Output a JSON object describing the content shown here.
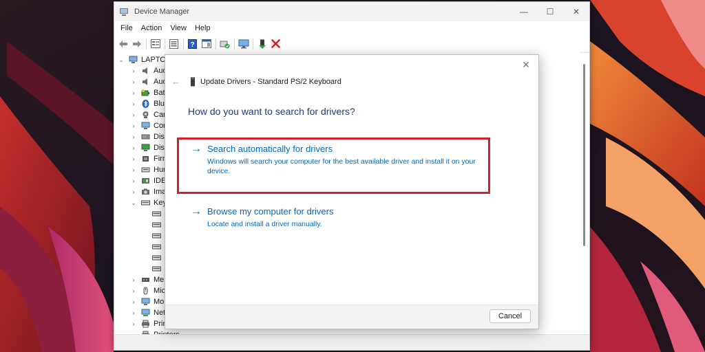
{
  "window": {
    "title": "Device Manager",
    "controls": {
      "minimize": "—",
      "maximize": "☐",
      "close": "✕"
    }
  },
  "menu": [
    "File",
    "Action",
    "View",
    "Help"
  ],
  "tree": {
    "root": "LAPTOP",
    "categories": [
      {
        "label": "Aud",
        "icon": "speaker-icon",
        "expanded": false
      },
      {
        "label": "Aud",
        "icon": "speaker-icon",
        "expanded": false
      },
      {
        "label": "Batt",
        "icon": "battery-icon",
        "expanded": false
      },
      {
        "label": "Blue",
        "icon": "bluetooth-icon",
        "expanded": false
      },
      {
        "label": "Can",
        "icon": "camera-icon",
        "expanded": false
      },
      {
        "label": "Com",
        "icon": "computer-icon",
        "expanded": false
      },
      {
        "label": "Disk",
        "icon": "disk-icon",
        "expanded": false
      },
      {
        "label": "Disp",
        "icon": "display-icon",
        "expanded": false
      },
      {
        "label": "Firm",
        "icon": "firmware-icon",
        "expanded": false
      },
      {
        "label": "Hum",
        "icon": "hid-icon",
        "expanded": false
      },
      {
        "label": "IDE",
        "icon": "ide-icon",
        "expanded": false
      },
      {
        "label": "Ima",
        "icon": "imaging-icon",
        "expanded": false
      },
      {
        "label": "Key",
        "icon": "keyboard-icon",
        "expanded": true
      }
    ],
    "keyboard_children": 6,
    "categories_after": [
      {
        "label": "Mer",
        "icon": "memory-icon"
      },
      {
        "label": "Mic",
        "icon": "mouse-icon"
      },
      {
        "label": "Mo",
        "icon": "monitor-icon"
      },
      {
        "label": "Net",
        "icon": "network-icon"
      },
      {
        "label": "Prin",
        "icon": "print-queue-icon"
      },
      {
        "label": "Printers",
        "icon": "printer-icon"
      }
    ]
  },
  "dialog": {
    "title": "Update Drivers - Standard PS/2 Keyboard",
    "close": "✕",
    "back": "←",
    "question": "How do you want to search for drivers?",
    "options": [
      {
        "title": "Search automatically for drivers",
        "description": "Windows will search your computer for the best available driver and install it on your device."
      },
      {
        "title": "Browse my computer for drivers",
        "description": "Locate and install a driver manually."
      }
    ],
    "cancel_label": "Cancel"
  },
  "colors": {
    "link_blue": "#0067c0",
    "question_blue": "#1e3b78",
    "highlight_red": "#d0202a"
  }
}
